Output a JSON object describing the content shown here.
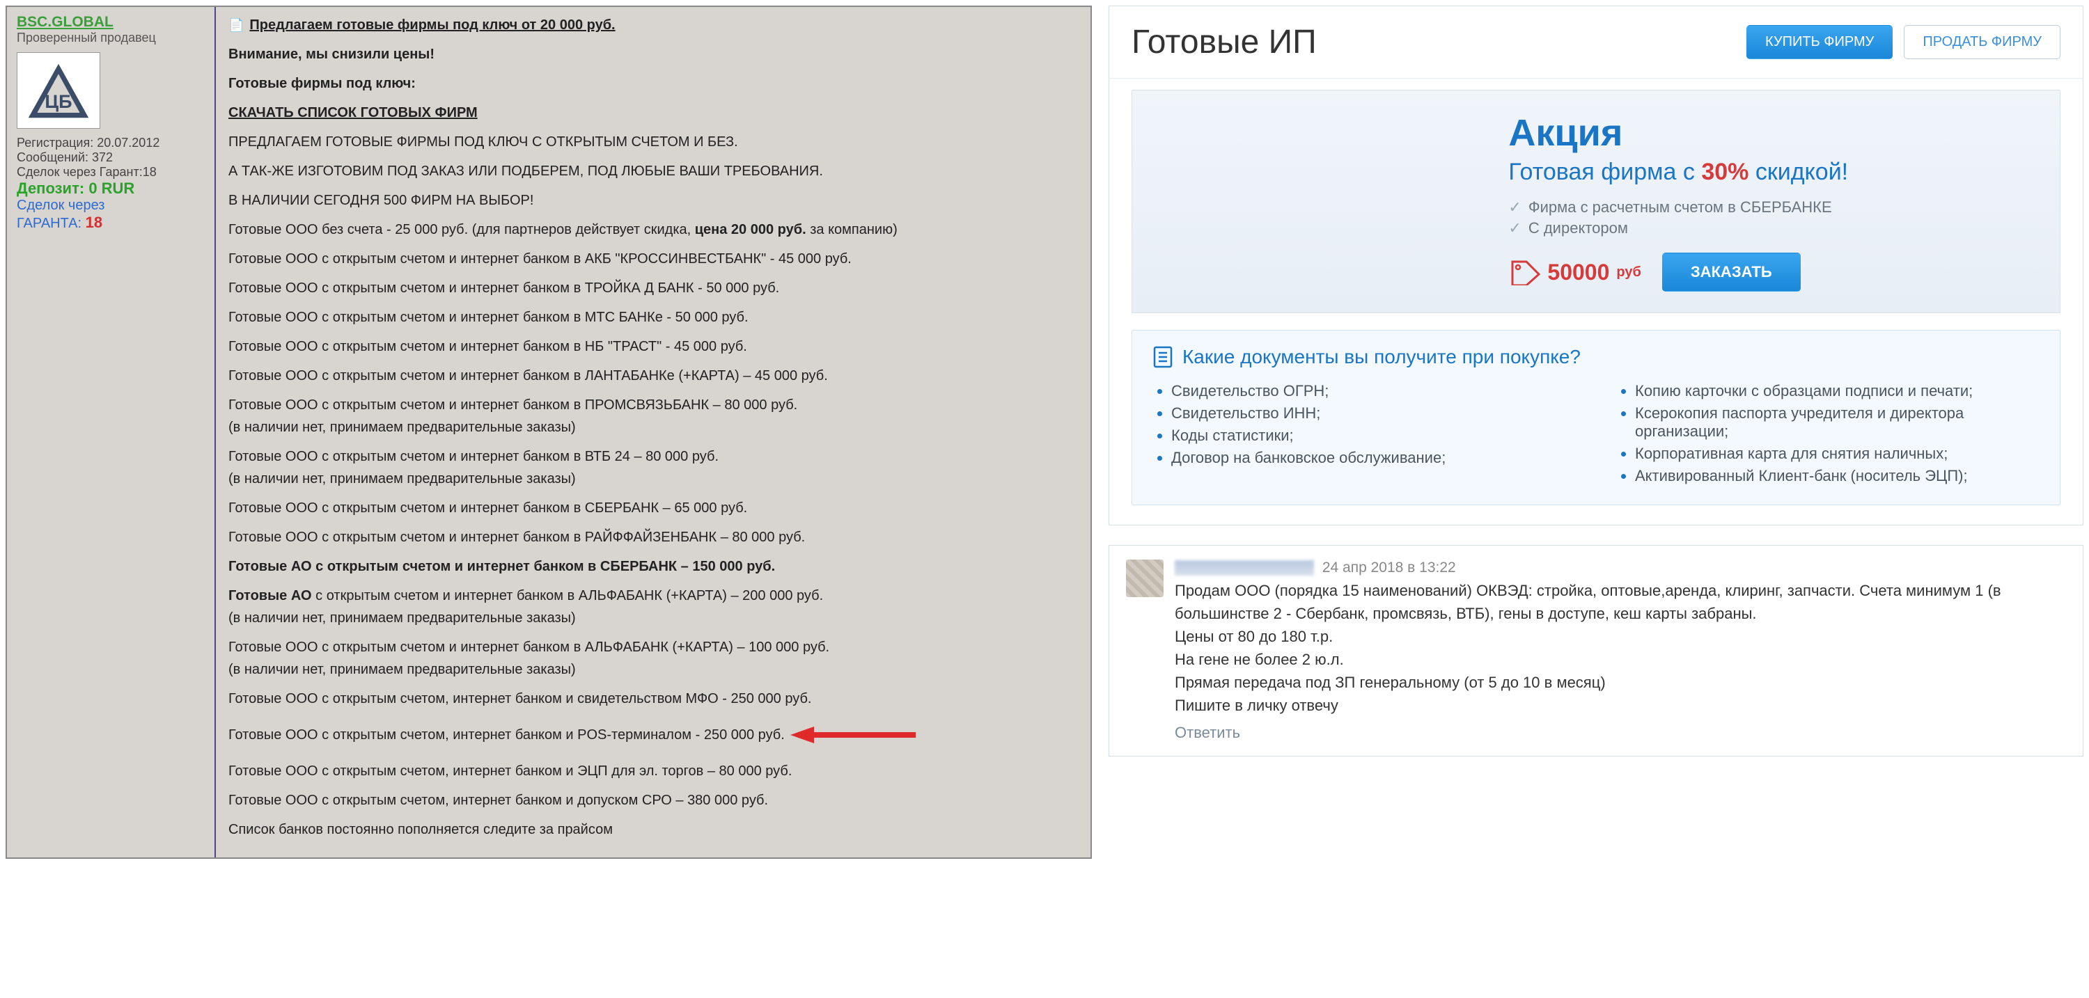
{
  "forum": {
    "seller": {
      "name": "BSC.GLOBAL",
      "verified": "Проверенный продавец",
      "reg_label": "Регистрация:",
      "reg_date": "20.07.2012",
      "msg_label": "Сообщений:",
      "msg_count": "372",
      "deals_label": "Сделок через Гарант:",
      "deals_count": "18",
      "deposit_label": "Депозит:",
      "deposit_value": "0 RUR",
      "garant_label": "Сделок через",
      "garant_label2": "ГАРАНТА:",
      "garant_count": "18"
    },
    "post": {
      "title": "Предлагаем готовые фирмы под ключ от 20 000 руб.",
      "line_attention": "Внимание, мы снизили цены!",
      "line_turnkey": "Готовые фирмы под ключ:",
      "dl_link": "СКАЧАТЬ СПИСОК ГОТОВЫХ ФИРМ",
      "offer_head": "ПРЕДЛАГАЕМ ГОТОВЫЕ ФИРМЫ ПОД КЛЮЧ С ОТКРЫТЫМ СЧЕТОМ И БЕЗ.",
      "offer_custom": "А ТАК-ЖЕ ИЗГОТОВИМ ПОД ЗАКАЗ ИЛИ ПОДБЕРЕМ, ПОД ЛЮБЫЕ ВАШИ ТРЕБОВАНИЯ.",
      "stock": "В НАЛИЧИИ СЕГОДНЯ 500 ФИРМ НА ВЫБОР!",
      "nosched_pre": "Готовые ООО без счета - 25 000 руб. (для партнеров действует скидка, ",
      "nosched_bold": "цена 20 000 руб.",
      "nosched_post": " за компанию)",
      "items": [
        "Готовые ООО с открытым счетом и интернет банком в АКБ \"КРОССИНВЕСТБАНК\" - 45 000 руб.",
        "Готовые ООО с открытым счетом и интернет банком в ТРОЙКА Д БАНК - 50 000 руб.",
        "Готовые ООО с открытым счетом и интернет банком в МТС БАНКе - 50 000 руб.",
        "Готовые ООО с открытым счетом и интернет банком в НБ \"ТРАСТ\" - 45 000 руб.",
        "Готовые ООО с открытым счетом и интернет банком в ЛАНТАБАНКе (+КАРТА) – 45 000 руб."
      ],
      "psb_main": "Готовые ООО с открытым счетом и интернет банком в ПРОМСВЯЗЬБАНК – 80 000 руб.",
      "psb_note": "(в наличии нет, принимаем предварительные заказы)",
      "vtb_main": "Готовые ООО с открытым счетом и интернет банком в ВТБ 24 – 80 000 руб.",
      "vtb_note": "(в наличии нет, принимаем предварительные заказы)",
      "sber": "Готовые ООО с открытым счетом и интернет банком в СБЕРБАНК – 65 000 руб.",
      "raif": "Готовые ООО с открытым счетом и интернет банком в РАЙФФАЙЗЕНБАНК – 80 000 руб.",
      "ao_sber": "Готовые АО с открытым счетом и интернет банком в СБЕРБАНК – 150 000 руб.",
      "ao_alfa_pre": "Готовые АО",
      "ao_alfa_rest": " с открытым счетом и интернет банком в АЛЬФАБАНК (+КАРТА) – 200 000 руб.",
      "ao_alfa_note": "(в наличии нет, принимаем предварительные заказы)",
      "ooo_alfa_main": "Готовые ООО с открытым счетом и интернет банком в АЛЬФАБАНК (+КАРТА) – 100 000 руб.",
      "ooo_alfa_note": "(в наличии нет, принимаем предварительные заказы)",
      "mfo": "Готовые ООО с открытым счетом, интернет банком и свидетельством МФО - 250 000 руб.",
      "pos": "Готовые ООО с открытым счетом, интернет банком и POS-терминалом - 250 000 руб.",
      "ecp": "Готовые ООО с открытым счетом, интернет банком и ЭЦП для эл. торгов – 80 000 руб.",
      "sro": "Готовые ООО с открытым счетом, интернет банком и допуском СРО – 380 000 руб.",
      "footer": "Список банков постоянно пополняется следите за прайсом"
    }
  },
  "site": {
    "title": "Готовые ИП",
    "buy_btn": "КУПИТЬ ФИРМУ",
    "sell_btn": "ПРОДАТЬ ФИРМУ",
    "promo": {
      "heading": "Акция",
      "sub_pre": "Готовая фирма с ",
      "sub_discount": "30%",
      "sub_post": " скидкой!",
      "feat1": "Фирма с расчетным счетом в СБЕРБАНКЕ",
      "feat2": "С директором",
      "price_val": "50000",
      "price_cur": "руб",
      "order": "ЗАКАЗАТЬ"
    },
    "docs": {
      "title": "Какие документы вы получите при покупке?",
      "left": [
        "Свидетельство ОГРН;",
        "Свидетельство ИНН;",
        "Коды статистики;",
        "Договор на банковское обслуживание;"
      ],
      "right": [
        "Копию карточки с образцами подписи и печати;",
        "Ксерокопия паспорта учредителя и директора организации;",
        "Корпоративная карта для снятия наличных;",
        "Активированный Клиент-банк (носитель ЭЦП);"
      ]
    }
  },
  "social": {
    "timestamp": "24 апр 2018 в 13:22",
    "line1": "Продам ООО (порядка 15 наименований) ОКВЭД: стройка, оптовые,аренда, клиринг, запчасти. Счета минимум 1 (в большинстве 2 - Сбербанк, промсвязь, ВТБ), гены в доступе, кеш карты забраны.",
    "line2": "Цены от 80 до 180 т.р.",
    "line3": "На гене не более 2 ю.л.",
    "line4": "Прямая передача под ЗП генеральному (от 5 до 10 в месяц)",
    "line5": "Пишите в личку отвечу",
    "reply": "Ответить"
  }
}
